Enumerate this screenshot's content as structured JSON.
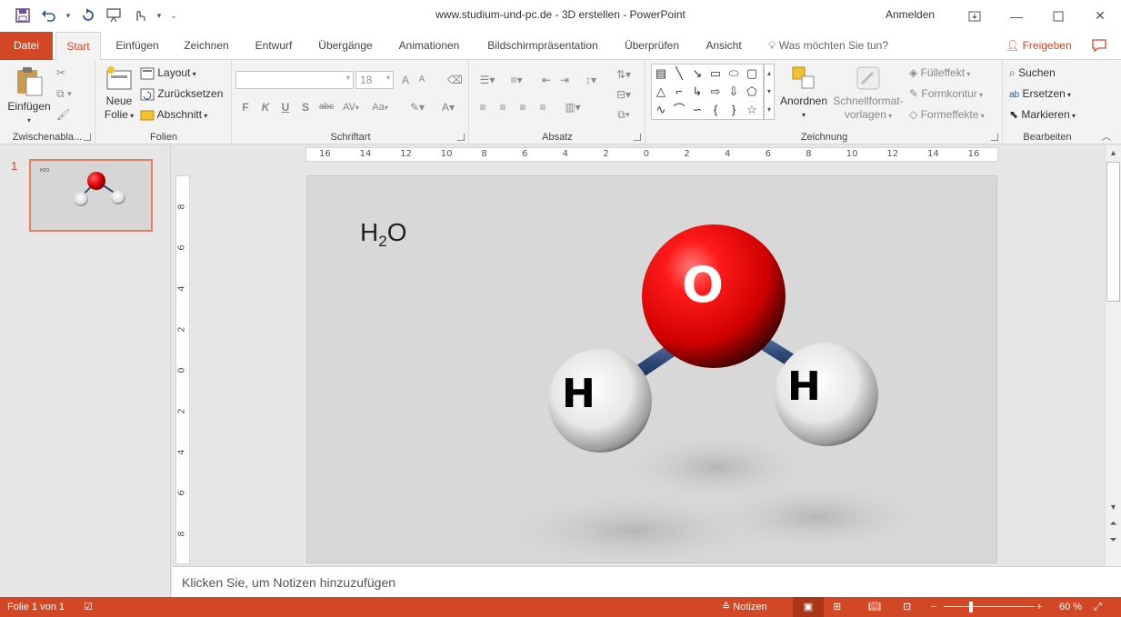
{
  "window": {
    "title": "www.studium-und-pc.de - 3D erstellen  -  PowerPoint",
    "signin": "Anmelden"
  },
  "tabs": {
    "file": "Datei",
    "items": [
      "Start",
      "Einfügen",
      "Zeichnen",
      "Entwurf",
      "Übergänge",
      "Animationen",
      "Bildschirmpräsentation",
      "Überprüfen",
      "Ansicht"
    ],
    "active": "Start",
    "tellme": "Was möchten Sie tun?",
    "share": "Freigeben"
  },
  "ribbon": {
    "clipboard": {
      "label": "Zwischenabla...",
      "paste": "Einfügen"
    },
    "slides": {
      "label": "Folien",
      "new_slide_1": "Neue",
      "new_slide_2": "Folie",
      "layout": "Layout",
      "reset": "Zurücksetzen",
      "section": "Abschnitt"
    },
    "font": {
      "label": "Schriftart",
      "size": "18",
      "bold": "F",
      "italic": "K",
      "underline": "U",
      "shadow": "S",
      "strike": "abc",
      "spacing": "AV",
      "case": "Aa"
    },
    "paragraph": {
      "label": "Absatz"
    },
    "drawing": {
      "label": "Zeichnung",
      "arrange": "Anordnen",
      "quickstyles_1": "Schnellformat-",
      "quickstyles_2": "vorlagen",
      "fill": "Fülleffekt",
      "outline": "Formkontur",
      "effects": "Formeffekte"
    },
    "editing": {
      "label": "Bearbeiten",
      "find": "Suchen",
      "replace": "Ersetzen",
      "select": "Markieren"
    }
  },
  "thumbnails": {
    "slide_number": "1",
    "title": "H2O"
  },
  "ruler": {
    "h_labels": [
      "16",
      "14",
      "12",
      "10",
      "8",
      "6",
      "4",
      "2",
      "0",
      "2",
      "4",
      "6",
      "8",
      "10",
      "12",
      "14",
      "16"
    ],
    "v_labels": [
      "8",
      "6",
      "4",
      "2",
      "0",
      "2",
      "4",
      "6",
      "8"
    ]
  },
  "slide": {
    "title_main": "H",
    "title_sub": "2",
    "title_end": "O",
    "atom_o": "O",
    "atom_h1": "H",
    "atom_h2": "H"
  },
  "notes": {
    "placeholder": "Klicken Sie, um Notizen hinzuzufügen"
  },
  "statusbar": {
    "slide_info": "Folie 1 von 1",
    "notes": "Notizen",
    "zoom": "60 %",
    "zoom_level": 0.6
  },
  "colors": {
    "accent": "#d24726",
    "oxygen": "#e00000",
    "bond": "#2f4a7a"
  }
}
